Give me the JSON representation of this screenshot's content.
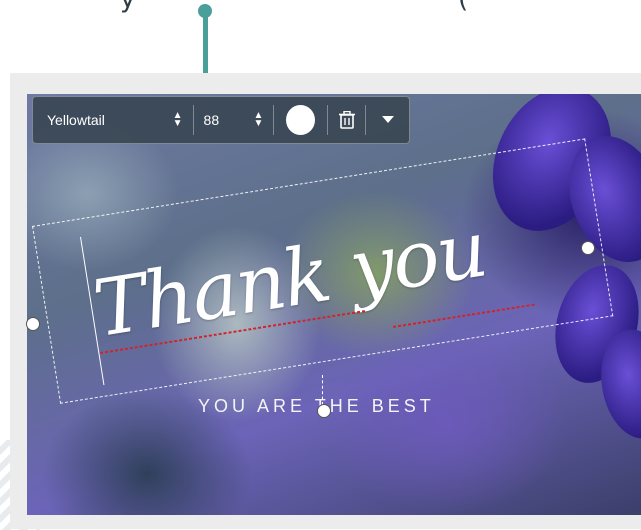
{
  "header_snippet": {
    "left_text": "y",
    "right_text": "("
  },
  "toolbar": {
    "font_name": "Yellowtail",
    "font_size": "88",
    "text_color": "#ffffff"
  },
  "canvas": {
    "headline": "Thank you",
    "subtitle": "YOU ARE THE BEST"
  },
  "colors": {
    "pointer_accent": "#4b9f9a",
    "spellcheck": "#d1242a"
  },
  "icons": {
    "font_stepper": "updown-icon",
    "size_stepper": "updown-icon",
    "delete": "trash-icon",
    "more": "chevron-down-icon"
  }
}
